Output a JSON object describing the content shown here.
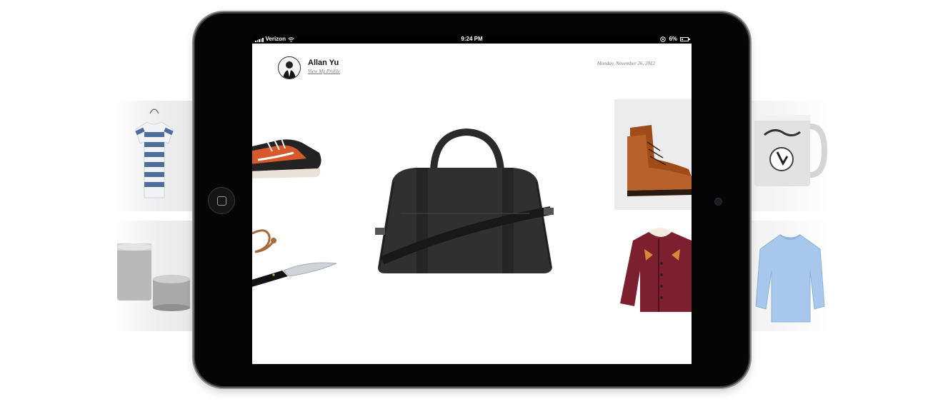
{
  "status_bar": {
    "carrier": "Verizon",
    "time": "9:24 PM",
    "battery": "6%",
    "icons": [
      "signal-bars-icon",
      "wifi-icon",
      "rotation-lock-icon",
      "battery-icon"
    ]
  },
  "profile": {
    "name": "Allan Yu",
    "link": "View My Profile"
  },
  "date": "Monday, November 26, 2012",
  "products": [
    {
      "name": "Striped T-Shirt",
      "color": "#4a6a96"
    },
    {
      "name": "Metal Canisters",
      "color": "#9d9d9d"
    },
    {
      "name": "Orange Sneakers",
      "color": "#d2542a"
    },
    {
      "name": "Folding Knife",
      "color": "#1a1a1a"
    },
    {
      "name": "Black Duffel Bag",
      "color": "#2a2a2a"
    },
    {
      "name": "Brown Leather Boots",
      "color": "#9a4a1c"
    },
    {
      "name": "Burgundy Jacket",
      "color": "#7a1e2a"
    },
    {
      "name": "Stussy Mug",
      "color": "#d8d8d8"
    },
    {
      "name": "Blue Sweater",
      "color": "#9cc0e6"
    }
  ]
}
